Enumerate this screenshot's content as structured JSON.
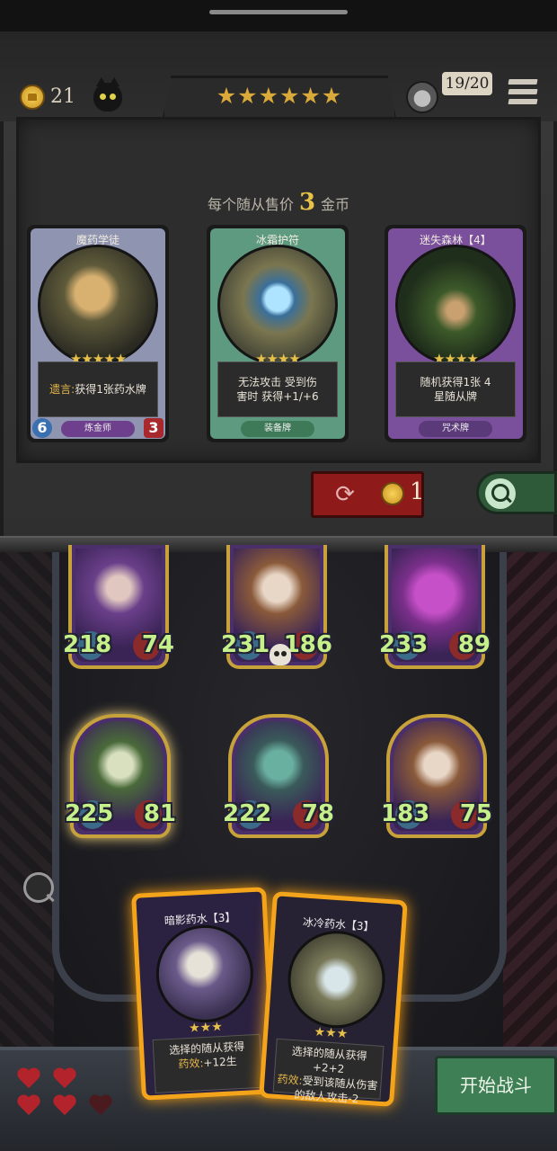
{
  "header": {
    "gold": "21",
    "stars": "★★★★★★",
    "round_counter": "19/20"
  },
  "shop": {
    "price_prefix": "每个随从售价",
    "price_value": "3",
    "price_suffix": "金币",
    "cards": [
      {
        "title": "魔药学徒",
        "stars": "★★★★★",
        "desc_keyword": "遗言:",
        "desc": "获得1张药水牌",
        "tag": "炼金师",
        "attack": "6",
        "health": "3",
        "frame_color": "#8f95b0"
      },
      {
        "title": "冰霜护符",
        "stars": "★★★★",
        "desc": "无法攻击 受到伤害时 获得+1/+6",
        "tag": "装备牌",
        "frame_color": "#5e9a7f"
      },
      {
        "title": "迷失森林【4】",
        "stars": "★★★★",
        "desc": "随机获得1张 4星随从牌",
        "tag": "咒术牌",
        "frame_color": "#7a4f9c"
      }
    ],
    "refresh_cost": "1"
  },
  "board": {
    "minions": [
      {
        "attack": "218",
        "health": "74"
      },
      {
        "attack": "231",
        "health": "186"
      },
      {
        "attack": "233",
        "health": "89"
      },
      {
        "attack": "225",
        "health": "81"
      },
      {
        "attack": "222",
        "health": "78"
      },
      {
        "attack": "183",
        "health": "75"
      }
    ]
  },
  "hand": [
    {
      "title": "暗影药水【3】",
      "stars": "★★★",
      "desc": "选择的随从获得",
      "effect_label": "药效:",
      "effect": "+12生"
    },
    {
      "title": "冰冷药水【3】",
      "stars": "★★★",
      "desc": "选择的随从获得+2+2",
      "effect_label": "药效:",
      "effect": "受到该随从伤害的敌人攻击-2"
    }
  ],
  "lives": {
    "full": 4,
    "total": 5
  },
  "start_battle_label": "开始战斗"
}
